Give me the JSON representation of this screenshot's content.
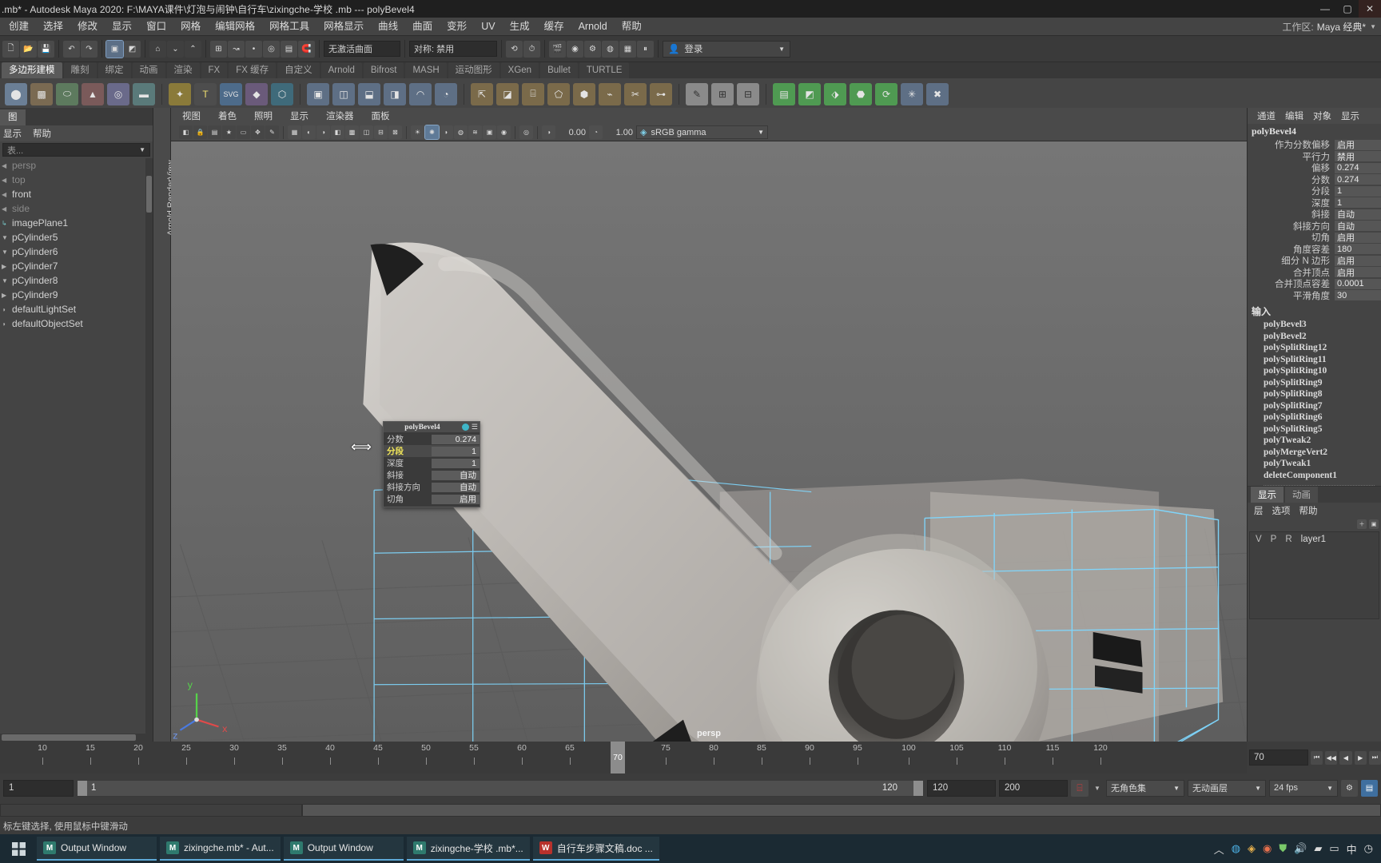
{
  "titlebar": {
    "text": " .mb* - Autodesk Maya 2020: F:\\MAYA课件\\灯泡与闹钟\\自行车\\zixingche-学校 .mb   ---   polyBevel4",
    "minimize": "—",
    "maximize": "▢",
    "close": "✕"
  },
  "menubar": {
    "items": [
      "创建",
      "选择",
      "修改",
      "显示",
      "窗口",
      "网格",
      "编辑网格",
      "网格工具",
      "网格显示",
      "曲线",
      "曲面",
      "变形",
      "UV",
      "生成",
      "缓存",
      "Arnold",
      "帮助"
    ],
    "workspace_label": "工作区:",
    "workspace_value": "Maya 经典*"
  },
  "statusbar": {
    "mode_field": "无激活曲面",
    "symmetry_label": "对称:",
    "symmetry_value": "禁用",
    "login_label": "登录",
    "icons": [
      "new-scene-icon",
      "open-scene-icon",
      "save-scene-icon",
      "undo-icon",
      "redo-icon",
      "select-tool-icon",
      "lasso-select-icon",
      "paint-select-icon",
      "move-tool-icon",
      "rotate-tool-icon",
      "scale-tool-icon",
      "snap-grid-icon",
      "snap-curve-icon",
      "snap-point-icon",
      "snap-view-plane-icon",
      "magnet-icon",
      "history-icon",
      "render-icon",
      "ipr-render-icon",
      "render-settings-icon",
      "pause-icon"
    ]
  },
  "shelf": {
    "tabs": [
      "多边形建模",
      "雕刻",
      "绑定",
      "动画",
      "渲染",
      "FX",
      "FX 缓存",
      "自定义",
      "Arnold",
      "Bifrost",
      "MASH",
      "运动图形",
      "XGen",
      "Bullet",
      "TURTLE"
    ],
    "active_tab": "多边形建模",
    "icons": [
      "sphere-icon",
      "cube-icon",
      "cylinder-icon",
      "cone-icon",
      "torus-icon",
      "plane-icon",
      "text-icon",
      "svg-icon",
      "sweep-mesh-icon",
      "type-icon",
      "bevel-icon",
      "bridge-icon",
      "combine-icon",
      "separate-icon",
      "smooth-icon",
      "extrude-icon",
      "booleans-icon",
      "mirror-icon",
      "cut-icon",
      "multi-cut-icon",
      "target-weld-icon",
      "quad-draw-icon",
      "insert-edge-loop-icon",
      "offset-edge-loop-icon",
      "connect-icon",
      "append-polygon-icon",
      "crease-icon",
      "sculpt-icon",
      "slide-edge-icon",
      "transfer-attributes-icon",
      "paint-weights-icon",
      "uv-editor-icon",
      "unfold-icon",
      "cleanup-icon",
      "reduce-icon",
      "triangulate-icon",
      "retopologize-icon",
      "remesh-icon",
      "smooth-proxy-icon",
      "delete-history-icon",
      "freeze-transform-icon"
    ]
  },
  "outliner": {
    "tab_label": "图",
    "menus": [
      "显示",
      "帮助"
    ],
    "search_placeholder": "表...",
    "items": [
      {
        "name": "persp",
        "kind": "camera",
        "expandable": true
      },
      {
        "name": "top",
        "kind": "camera",
        "expandable": true
      },
      {
        "name": "front",
        "kind": "camera",
        "expandable": true
      },
      {
        "name": "side",
        "kind": "camera",
        "expandable": true
      },
      {
        "name": "imagePlane1",
        "kind": "imageplane",
        "expandable": false
      },
      {
        "name": "pCylinder5",
        "kind": "mesh",
        "expandable": true
      },
      {
        "name": "pCylinder6",
        "kind": "mesh",
        "expandable": true
      },
      {
        "name": "pCylinder7",
        "kind": "mesh",
        "expandable": true
      },
      {
        "name": "pCylinder8",
        "kind": "mesh",
        "expandable": true
      },
      {
        "name": "pCylinder9",
        "kind": "mesh",
        "expandable": true
      },
      {
        "name": "defaultLightSet",
        "kind": "set",
        "expandable": true
      },
      {
        "name": "defaultObjectSet",
        "kind": "set",
        "expandable": true
      }
    ]
  },
  "arnold_tab": "Arnold RenderView",
  "viewport": {
    "menus": [
      "视图",
      "着色",
      "照明",
      "显示",
      "渲染器",
      "面板"
    ],
    "exposure_value": "0.00",
    "gamma_value": "1.00",
    "colorspace": "sRGB gamma",
    "camera_label": "persp",
    "axis_labels": {
      "x": "x",
      "y": "y",
      "z": "z"
    }
  },
  "tool_popup": {
    "title": "polyBevel4",
    "rows": [
      {
        "label": "分数",
        "value": "0.274",
        "highlight": false
      },
      {
        "label": "分段",
        "value": "1",
        "highlight": true
      },
      {
        "label": "深度",
        "value": "1",
        "highlight": false
      },
      {
        "label": "斜接",
        "value": "自动",
        "highlight": false
      },
      {
        "label": "斜接方向",
        "value": "自动",
        "highlight": false
      },
      {
        "label": "切角",
        "value": "启用",
        "highlight": false
      }
    ]
  },
  "channelbox": {
    "menus": [
      "通道",
      "编辑",
      "对象",
      "显示"
    ],
    "node_title": "polyBevel4",
    "attributes": [
      {
        "label": "作为分数偏移",
        "value": "启用"
      },
      {
        "label": "平行力",
        "value": "禁用"
      },
      {
        "label": "偏移",
        "value": "0.274"
      },
      {
        "label": "分数",
        "value": "0.274"
      },
      {
        "label": "分段",
        "value": "1"
      },
      {
        "label": "深度",
        "value": "1"
      },
      {
        "label": "斜接",
        "value": "自动"
      },
      {
        "label": "斜接方向",
        "value": "自动"
      },
      {
        "label": "切角",
        "value": "启用"
      },
      {
        "label": "角度容差",
        "value": "180"
      },
      {
        "label": "细分 N 边形",
        "value": "启用"
      },
      {
        "label": "合并顶点",
        "value": "启用"
      },
      {
        "label": "合并顶点容差",
        "value": "0.0001"
      },
      {
        "label": "平滑角度",
        "value": "30"
      }
    ],
    "inputs_header": "输入",
    "inputs": [
      "polyBevel3",
      "polyBevel2",
      "polySplitRing12",
      "polySplitRing11",
      "polySplitRing10",
      "polySplitRing9",
      "polySplitRing8",
      "polySplitRing7",
      "polySplitRing6",
      "polySplitRing5",
      "polyTweak2",
      "polyMergeVert2",
      "polyTweak1",
      "deleteComponent1"
    ]
  },
  "layereditor": {
    "tabs": [
      "显示",
      "动画"
    ],
    "active_tab": "显示",
    "menus": [
      "层",
      "选项",
      "帮助"
    ],
    "columns": [
      "V",
      "P",
      "R"
    ],
    "layers": [
      {
        "name": "layer1",
        "v": "V",
        "p": "P",
        "r": "R"
      }
    ]
  },
  "timeline": {
    "ticks": [
      "10",
      "15",
      "20",
      "25",
      "30",
      "35",
      "40",
      "45",
      "50",
      "55",
      "60",
      "65",
      "70",
      "75",
      "80",
      "85",
      "90",
      "95",
      "100",
      "105",
      "110",
      "115",
      "120"
    ],
    "current_frame": "70",
    "current_frame_field": "70",
    "transport": [
      "go-to-start-icon",
      "step-back-key-icon",
      "step-back-frame-icon",
      "play-backwards-icon",
      "play-forwards-icon",
      "step-forward-frame-icon",
      "step-forward-key-icon",
      "go-to-end-icon"
    ]
  },
  "rangebar": {
    "start_field": "1",
    "range_start": "1",
    "range_end": "120",
    "anim_start": "120",
    "anim_end": "200",
    "character_set": "无角色集",
    "anim_layer": "无动画层",
    "fps": "24 fps",
    "auto_key_icon": "auto-key-icon",
    "prefs_icon": "animation-preferences-icon"
  },
  "helpline": {
    "text": "标左键选择, 使用鼠标中键滑动"
  },
  "taskbar": {
    "items": [
      {
        "label": "Output Window",
        "app": "M",
        "kind": "maya"
      },
      {
        "label": "zixingche.mb* - Aut...",
        "app": "M",
        "kind": "maya"
      },
      {
        "label": "Output Window",
        "app": "M",
        "kind": "maya"
      },
      {
        "label": "zixingche-学校 .mb*...",
        "app": "M",
        "kind": "maya"
      },
      {
        "label": "自行车步骤文稿.doc ...",
        "app": "W",
        "kind": "word"
      }
    ],
    "tray": [
      "^",
      "chrome-icon",
      "chat-icon",
      "firefox-icon",
      "shield-icon",
      "volume-icon",
      "network-icon",
      "battery-icon",
      "ime-icon",
      "clock-icon"
    ]
  }
}
